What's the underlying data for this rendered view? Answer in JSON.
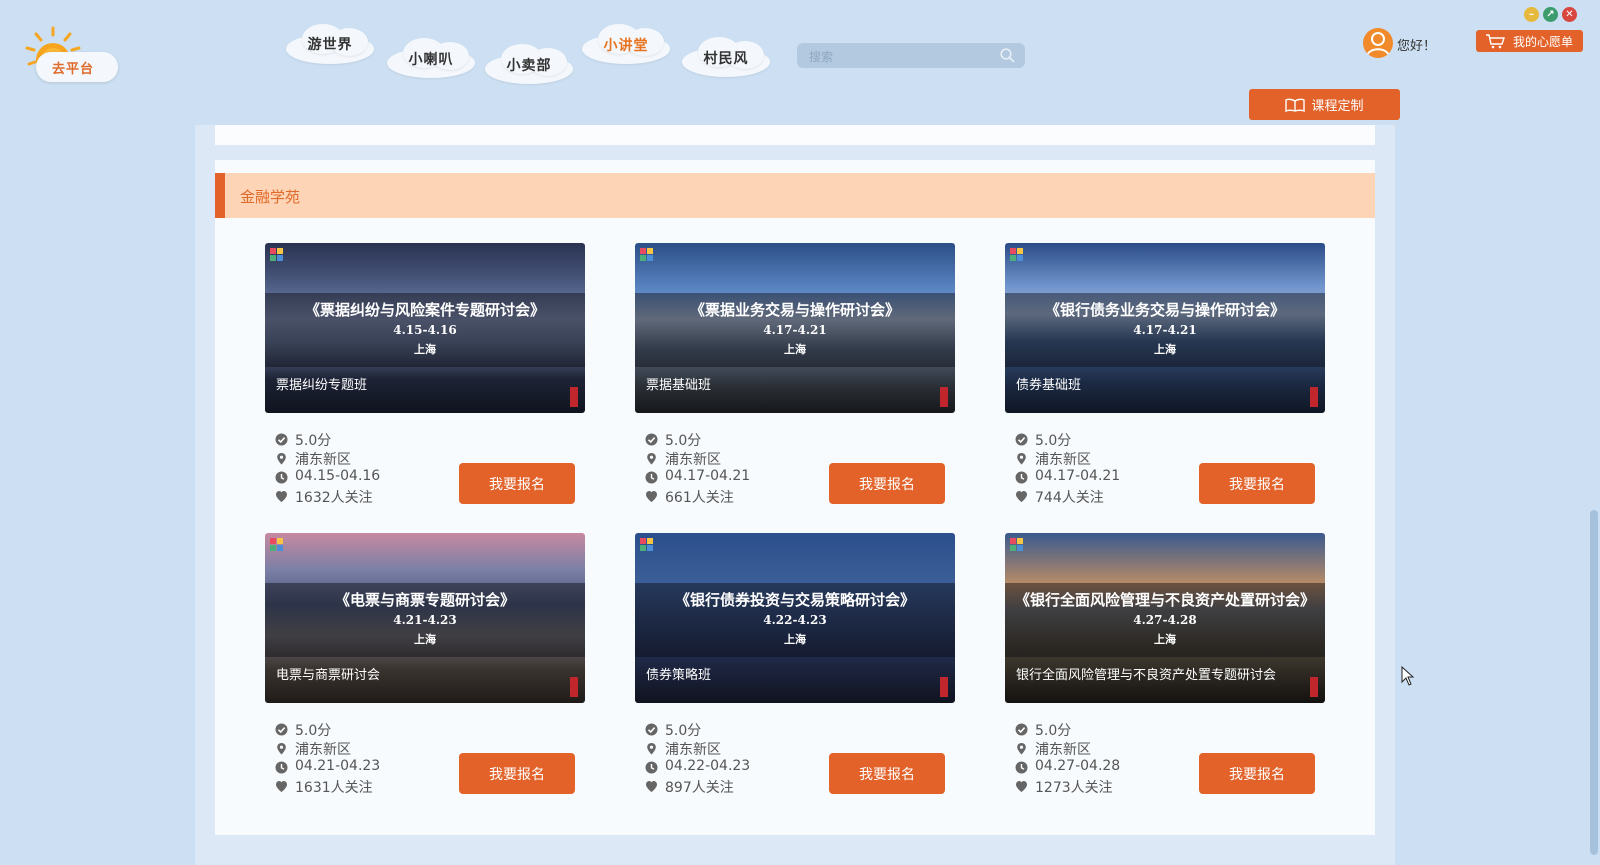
{
  "logo": {
    "text": "去平台"
  },
  "nav": [
    {
      "label": "游世界"
    },
    {
      "label": "小喇叭"
    },
    {
      "label": "小卖部"
    },
    {
      "label": "小讲堂",
      "active": true
    },
    {
      "label": "村民风"
    }
  ],
  "search": {
    "placeholder": "搜索",
    "value": ""
  },
  "user": {
    "greeting": "您好！"
  },
  "wishlist": {
    "label": "我的心愿单"
  },
  "custom_course": {
    "label": "课程定制"
  },
  "section": {
    "title": "金融学苑"
  },
  "courses": [
    {
      "title": "《票据纠纷与风险案件专题研讨会》",
      "dates_banner": "4.15-4.16",
      "city": "上海",
      "name": "票据纠纷专题班",
      "rating": "5.0分",
      "location": "浦东新区",
      "dates": "04.15-04.16",
      "followers": "1632人关注",
      "enroll_label": "我要报名"
    },
    {
      "title": "《票据业务交易与操作研讨会》",
      "dates_banner": "4.17-4.21",
      "city": "上海",
      "name": "票据基础班",
      "rating": "5.0分",
      "location": "浦东新区",
      "dates": "04.17-04.21",
      "followers": "661人关注",
      "enroll_label": "我要报名"
    },
    {
      "title": "《银行债务业务交易与操作研讨会》",
      "dates_banner": "4.17-4.21",
      "city": "上海",
      "name": "债券基础班",
      "rating": "5.0分",
      "location": "浦东新区",
      "dates": "04.17-04.21",
      "followers": "744人关注",
      "enroll_label": "我要报名"
    },
    {
      "title": "《电票与商票专题研讨会》",
      "dates_banner": "4.21-4.23",
      "city": "上海",
      "name": "电票与商票研讨会",
      "rating": "5.0分",
      "location": "浦东新区",
      "dates": "04.21-04.23",
      "followers": "1631人关注",
      "enroll_label": "我要报名"
    },
    {
      "title": "《银行债券投资与交易策略研讨会》",
      "dates_banner": "4.22-4.23",
      "city": "上海",
      "name": "债券策略班",
      "rating": "5.0分",
      "location": "浦东新区",
      "dates": "04.22-04.23",
      "followers": "897人关注",
      "enroll_label": "我要报名"
    },
    {
      "title": "《银行全面风险管理与不良资产处置研讨会》",
      "dates_banner": "4.27-4.28",
      "city": "上海",
      "name": "银行全面风险管理与不良资产处置专题研讨会",
      "rating": "5.0分",
      "location": "浦东新区",
      "dates": "04.27-04.28",
      "followers": "1273人关注",
      "enroll_label": "我要报名"
    }
  ],
  "colors": {
    "accent": "#e2622a",
    "background": "#cde0f3",
    "section_header": "#fdd4b5"
  }
}
